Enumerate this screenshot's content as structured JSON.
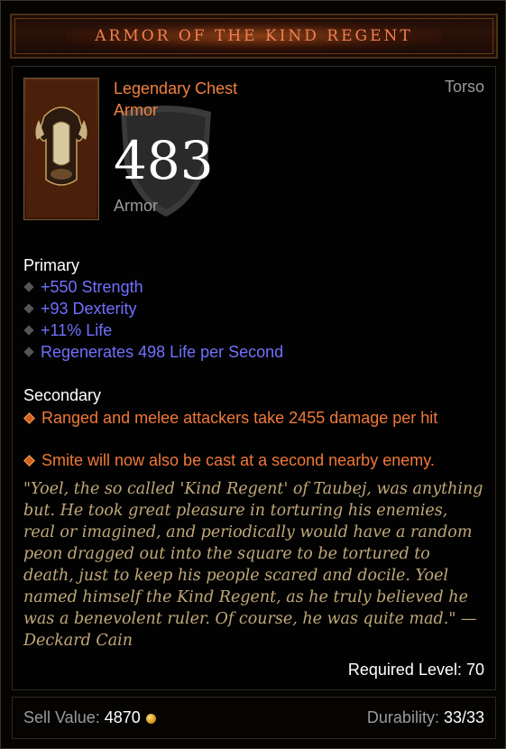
{
  "header": {
    "title": "Armor of the Kind Regent"
  },
  "item": {
    "type_line1": "Legendary Chest",
    "type_line2": "Armor",
    "slot": "Torso",
    "armor_value": "483",
    "armor_label": "Armor",
    "icon": "chest-armor-icon"
  },
  "primary": {
    "label": "Primary",
    "stats": [
      "+550 Strength",
      "+93 Dexterity",
      "+11% Life",
      "Regenerates 498 Life per Second"
    ]
  },
  "secondary": {
    "label": "Secondary",
    "stats": [
      "Ranged and melee attackers take 2455 damage per hit",
      "Smite will now also be cast at a second nearby enemy."
    ]
  },
  "flavor_text": "\"Yoel, the so called 'Kind Regent' of Taubej, was anything but. He took great pleasure in torturing his enemies, real or imagined, and periodically would have a random peon dragged out into the square to be tortured to death, just to keep his people scared and docile. Yoel named himself the Kind Regent, as he truly believed he was a benevolent ruler. Of course, he was quite mad.\" —Deckard Cain",
  "required_level": "Required Level: 70",
  "footer": {
    "sell_label": "Sell Value: ",
    "sell_value": "4870",
    "durability_label": "Durability: ",
    "durability_value": "33/33"
  },
  "colors": {
    "legendary": "#f08040",
    "magic": "#7070ff",
    "flavor": "#c0a877"
  }
}
